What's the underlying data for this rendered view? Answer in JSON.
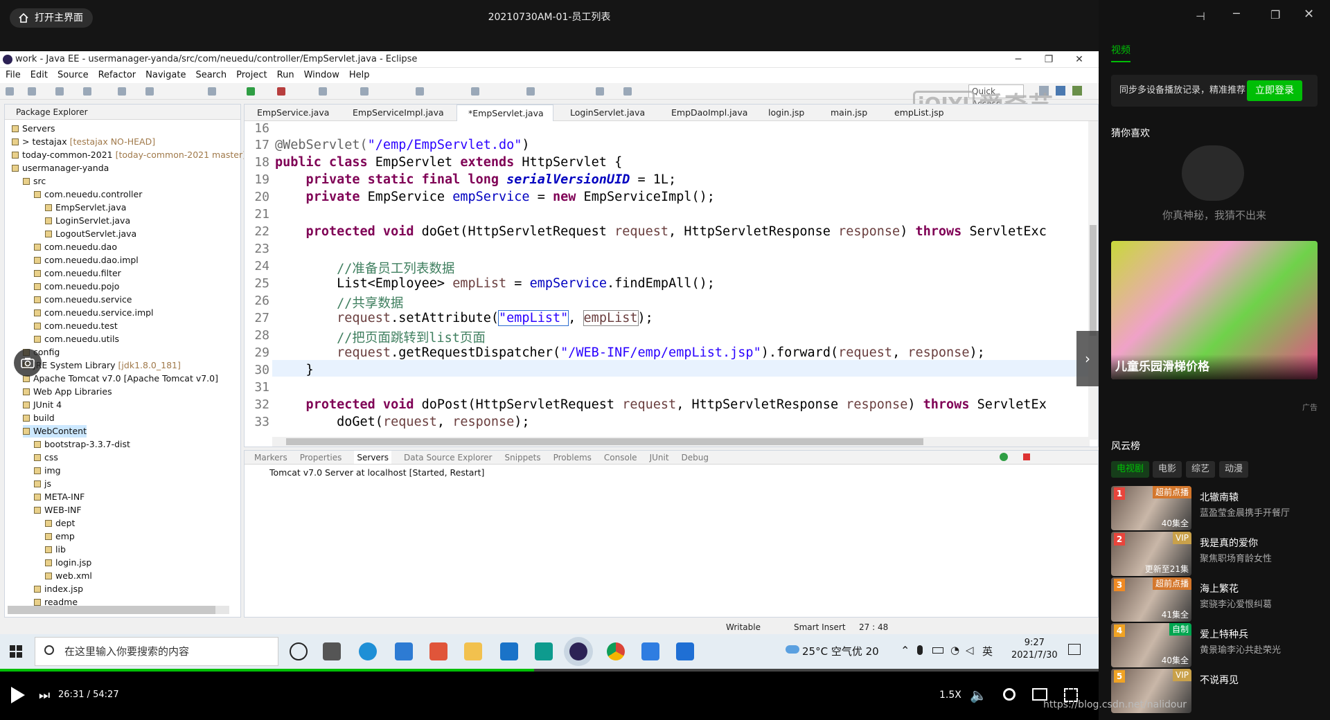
{
  "player_top": {
    "home_label": "打开主界面",
    "video_title": "20210730AM-01-员工列表"
  },
  "eclipse": {
    "window_title": "work - Java EE - usermanager-yanda/src/com/neuedu/controller/EmpServlet.java - Eclipse",
    "menu": [
      "File",
      "Edit",
      "Source",
      "Refactor",
      "Navigate",
      "Search",
      "Project",
      "Run",
      "Window",
      "Help"
    ],
    "quick_access": "Quick Access",
    "package_explorer": {
      "title": "Package Explorer",
      "items": [
        {
          "label": "Servers",
          "dec": "",
          "indent": 0
        },
        {
          "label": "> testajax",
          "dec": "[testajax NO-HEAD]",
          "indent": 0
        },
        {
          "label": "today-common-2021",
          "dec": "[today-common-2021 master]",
          "indent": 0
        },
        {
          "label": "usermanager-yanda",
          "dec": "",
          "indent": 0
        },
        {
          "label": "src",
          "dec": "",
          "indent": 1
        },
        {
          "label": "com.neuedu.controller",
          "dec": "",
          "indent": 2
        },
        {
          "label": "EmpServlet.java",
          "dec": "",
          "indent": 3
        },
        {
          "label": "LoginServlet.java",
          "dec": "",
          "indent": 3
        },
        {
          "label": "LogoutServlet.java",
          "dec": "",
          "indent": 3
        },
        {
          "label": "com.neuedu.dao",
          "dec": "",
          "indent": 2
        },
        {
          "label": "com.neuedu.dao.impl",
          "dec": "",
          "indent": 2
        },
        {
          "label": "com.neuedu.filter",
          "dec": "",
          "indent": 2
        },
        {
          "label": "com.neuedu.pojo",
          "dec": "",
          "indent": 2
        },
        {
          "label": "com.neuedu.service",
          "dec": "",
          "indent": 2
        },
        {
          "label": "com.neuedu.service.impl",
          "dec": "",
          "indent": 2
        },
        {
          "label": "com.neuedu.test",
          "dec": "",
          "indent": 2
        },
        {
          "label": "com.neuedu.utils",
          "dec": "",
          "indent": 2
        },
        {
          "label": "config",
          "dec": "",
          "indent": 1
        },
        {
          "label": "JRE System Library",
          "dec": "[jdk1.8.0_181]",
          "indent": 1
        },
        {
          "label": "Apache Tomcat v7.0 [Apache Tomcat v7.0]",
          "dec": "",
          "indent": 1
        },
        {
          "label": "Web App Libraries",
          "dec": "",
          "indent": 1
        },
        {
          "label": "JUnit 4",
          "dec": "",
          "indent": 1
        },
        {
          "label": "build",
          "dec": "",
          "indent": 1
        },
        {
          "label": "WebContent",
          "dec": "",
          "indent": 1
        },
        {
          "label": "bootstrap-3.3.7-dist",
          "dec": "",
          "indent": 2
        },
        {
          "label": "css",
          "dec": "",
          "indent": 2
        },
        {
          "label": "img",
          "dec": "",
          "indent": 2
        },
        {
          "label": "js",
          "dec": "",
          "indent": 2
        },
        {
          "label": "META-INF",
          "dec": "",
          "indent": 2
        },
        {
          "label": "WEB-INF",
          "dec": "",
          "indent": 2
        },
        {
          "label": "dept",
          "dec": "",
          "indent": 3
        },
        {
          "label": "emp",
          "dec": "",
          "indent": 3
        },
        {
          "label": "lib",
          "dec": "",
          "indent": 3
        },
        {
          "label": "login.jsp",
          "dec": "",
          "indent": 3
        },
        {
          "label": "web.xml",
          "dec": "",
          "indent": 3
        },
        {
          "label": "index.jsp",
          "dec": "",
          "indent": 2
        },
        {
          "label": "readme",
          "dec": "",
          "indent": 2
        }
      ]
    },
    "editor_tabs": [
      "EmpService.java",
      "EmpServiceImpl.java",
      "*EmpServlet.java",
      "LoginServlet.java",
      "EmpDaoImpl.java",
      "login.jsp",
      "main.jsp",
      "empList.jsp"
    ],
    "line_numbers": [
      "16",
      "17",
      "18",
      "19",
      "20",
      "21",
      "22",
      "23",
      "24",
      "25",
      "26",
      "27",
      "28",
      "29",
      "30",
      "31",
      "32",
      "33"
    ],
    "code": {
      "l17a": "@WebServlet(",
      "l17b": "\"/emp/EmpServlet.do\"",
      "l17c": ")",
      "l18a": "public class",
      "l18b": " EmpServlet ",
      "l18c": "extends",
      "l18d": " HttpServlet {",
      "l19a": "    private static final long ",
      "l19b": "serialVersionUID",
      "l19c": " = 1L;",
      "l20a": "    private",
      "l20b": " EmpService ",
      "l20c": "empService",
      "l20d": " = ",
      "l20e": "new",
      "l20f": " EmpServiceImpl();",
      "l22a": "    protected void",
      "l22b": " doGet(HttpServletRequest ",
      "l22c": "request",
      "l22d": ", HttpServletResponse ",
      "l22e": "response",
      "l22f": ") ",
      "l22g": "throws",
      "l22h": " ServletExc",
      "l24": "        //准备员工列表数据",
      "l25a": "        List<Employee> ",
      "l25b": "empList",
      "l25c": " = ",
      "l25d": "empService",
      "l25e": ".findEmpAll();",
      "l26": "        //共享数据",
      "l27a": "        ",
      "l27b": "request",
      "l27c": ".setAttribute(",
      "l27d": "\"empList\"",
      "l27e": ", ",
      "l27f": "empList",
      "l27g": ");",
      "l28": "        //把页面跳转到list页面",
      "l29a": "        ",
      "l29b": "request",
      "l29c": ".getRequestDispatcher(",
      "l29d": "\"/WEB-INF/emp/empList.jsp\"",
      "l29e": ").forward(",
      "l29f": "request",
      "l29g": ", ",
      "l29h": "response",
      "l29i": ");",
      "l30": "    }",
      "l32a": "    protected void",
      "l32b": " doPost(HttpServletRequest ",
      "l32c": "request",
      "l32d": ", HttpServletResponse ",
      "l32e": "response",
      "l32f": ") ",
      "l32g": "throws",
      "l32h": " ServletEx",
      "l33a": "        doGet(",
      "l33b": "request",
      "l33c": ", ",
      "l33d": "response",
      "l33e": ");"
    },
    "bottom_tabs": [
      "Markers",
      "Properties",
      "Servers",
      "Data Source Explorer",
      "Snippets",
      "Problems",
      "Console",
      "JUnit",
      "Debug"
    ],
    "server_row": "Tomcat v7.0 Server at localhost  [Started, Restart]",
    "status": {
      "writable": "Writable",
      "insert": "Smart Insert",
      "position": "27 : 48"
    },
    "watermark": "爱奇艺"
  },
  "taskbar": {
    "search_placeholder": "在这里输入你要搜索的内容",
    "weather": "25°C  空气优 20",
    "ime": "英",
    "time": "9:27",
    "date": "2021/7/30"
  },
  "player_bottom": {
    "current": "26:31",
    "total": "54:27",
    "time_sep": " / ",
    "speed": "1.5X",
    "progress": 0.486
  },
  "sidebar": {
    "tab_video": "视频",
    "promo_text": "同步多设备播放记录，精准推荐",
    "login_label": "立即登录",
    "guess_title": "猜你喜欢",
    "guess_empty": "你真神秘，我猜不出来",
    "ad_caption": "儿童乐园滑梯价格",
    "ad_label": "广告",
    "chart_title": "风云榜",
    "categories": [
      "电视剧",
      "电影",
      "综艺",
      "动漫"
    ],
    "rank": [
      {
        "num": "1",
        "badge": "超前点播",
        "ep": "40集全",
        "title": "北辙南辕",
        "sub": "蓝盈莹金晨携手开餐厅",
        "color": "#e8453c"
      },
      {
        "num": "2",
        "badge": "VIP",
        "ep": "更新至21集",
        "title": "我是真的爱你",
        "sub": "聚焦职场育龄女性",
        "color": "#e8453c"
      },
      {
        "num": "3",
        "badge": "超前点播",
        "ep": "41集全",
        "title": "海上繁花",
        "sub": "窦骁李沁爱恨纠葛",
        "color": "#f08a24"
      },
      {
        "num": "4",
        "badge": "自制",
        "ep": "40集全",
        "title": "爱上特种兵",
        "sub": "黄景瑜李沁共赴荣光",
        "color": "#f0a324"
      },
      {
        "num": "5",
        "badge": "VIP",
        "ep": "",
        "title": "不说再见",
        "sub": "",
        "color": "#f0a324"
      }
    ],
    "watermark_url": "https://blog.csdn.net/nalidour"
  }
}
